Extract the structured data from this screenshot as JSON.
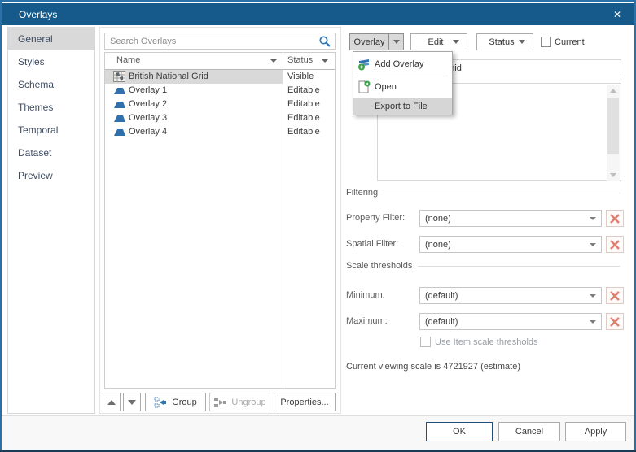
{
  "window": {
    "title": "Overlays",
    "close_glyph": "✕"
  },
  "sidebar": {
    "items": [
      {
        "label": "General"
      },
      {
        "label": "Styles"
      },
      {
        "label": "Schema"
      },
      {
        "label": "Themes"
      },
      {
        "label": "Temporal"
      },
      {
        "label": "Dataset"
      },
      {
        "label": "Preview"
      }
    ]
  },
  "list": {
    "search_placeholder": "Search Overlays",
    "name_column": "Name",
    "status_column": "Status",
    "rows": [
      {
        "name": "British National Grid",
        "status": "Visible"
      },
      {
        "name": "Overlay 1",
        "status": "Editable"
      },
      {
        "name": "Overlay 2",
        "status": "Editable"
      },
      {
        "name": "Overlay 3",
        "status": "Editable"
      },
      {
        "name": "Overlay 4",
        "status": "Editable"
      }
    ],
    "group_label": "Group",
    "ungroup_label": "Ungroup",
    "properties_label": "Properties..."
  },
  "toolbar": {
    "overlay_label": "Overlay",
    "edit_label": "Edit",
    "status_label": "Status",
    "current_label": "Current"
  },
  "overlay_menu": {
    "add_label": "Add Overlay",
    "open_label": "Open",
    "export_label": "Export to File"
  },
  "properties": {
    "name_value": "British National Grid",
    "filtering_heading": "Filtering",
    "property_filter_label": "Property Filter:",
    "property_filter_value": "(none)",
    "spatial_filter_label": "Spatial Filter:",
    "spatial_filter_value": "(none)",
    "scale_heading": "Scale thresholds",
    "minimum_label": "Minimum:",
    "minimum_value": "(default)",
    "maximum_label": "Maximum:",
    "maximum_value": "(default)",
    "use_item_label": "Use Item scale thresholds",
    "scale_note": "Current viewing scale is 4721927 (estimate)"
  },
  "footer": {
    "ok_label": "OK",
    "cancel_label": "Cancel",
    "apply_label": "Apply"
  },
  "colors": {
    "titlebar": "#155a8b",
    "dialog_border": "#2a70a9",
    "accent": "#2e75b5",
    "selection": "#d9d9d9",
    "danger": "#dd7f70"
  }
}
